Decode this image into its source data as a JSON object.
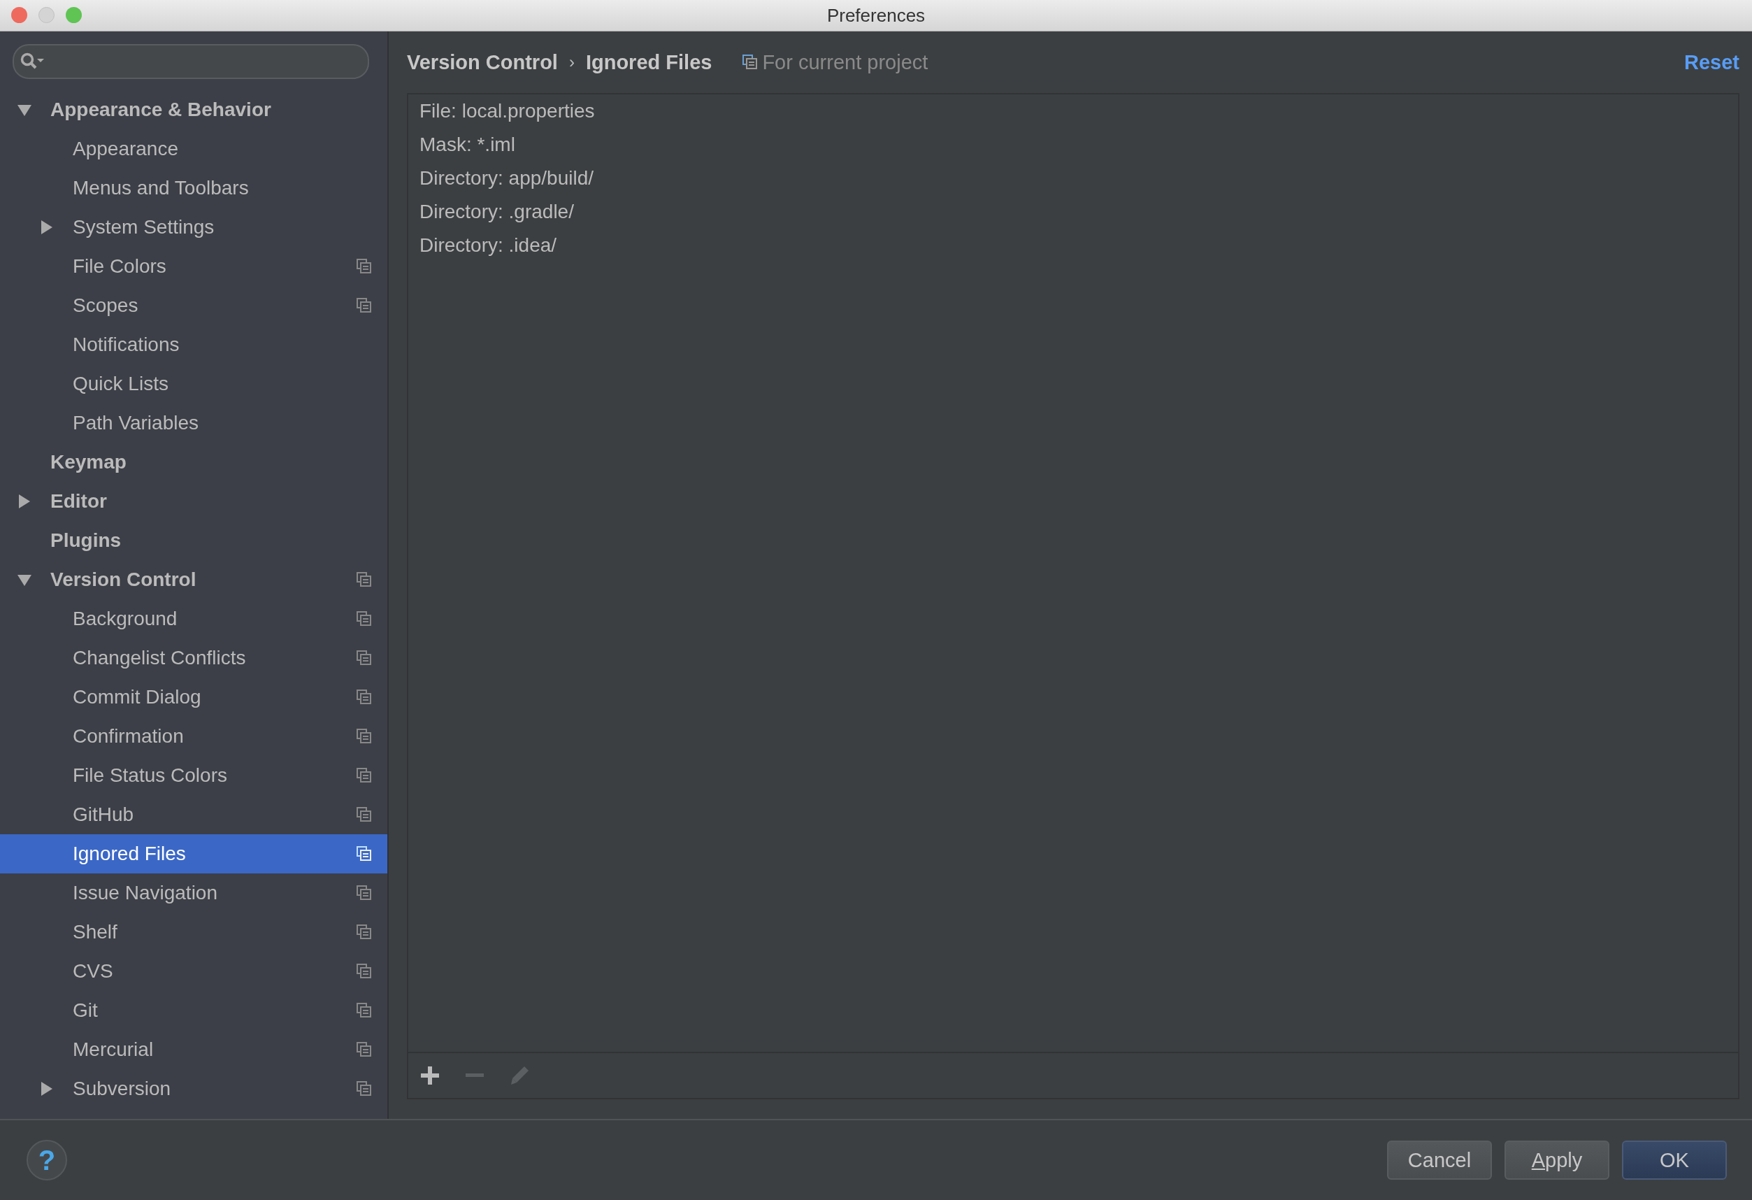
{
  "window": {
    "title": "Preferences"
  },
  "sidebar": {
    "items": [
      {
        "label": "Appearance & Behavior",
        "selected": false,
        "expanded": true,
        "project_level": false,
        "children": [
          {
            "label": "Appearance",
            "selected": false,
            "project_level": false
          },
          {
            "label": "Menus and Toolbars",
            "selected": false,
            "project_level": false
          },
          {
            "label": "System Settings",
            "selected": false,
            "expanded": false,
            "project_level": false
          },
          {
            "label": "File Colors",
            "selected": false,
            "project_level": true
          },
          {
            "label": "Scopes",
            "selected": false,
            "project_level": true
          },
          {
            "label": "Notifications",
            "selected": false,
            "project_level": false
          },
          {
            "label": "Quick Lists",
            "selected": false,
            "project_level": false
          },
          {
            "label": "Path Variables",
            "selected": false,
            "project_level": false
          }
        ]
      },
      {
        "label": "Keymap",
        "selected": false,
        "project_level": false
      },
      {
        "label": "Editor",
        "selected": false,
        "expanded": false,
        "project_level": false
      },
      {
        "label": "Plugins",
        "selected": false,
        "project_level": false
      },
      {
        "label": "Version Control",
        "selected": false,
        "expanded": true,
        "project_level": true,
        "children": [
          {
            "label": "Background",
            "selected": false,
            "project_level": true
          },
          {
            "label": "Changelist Conflicts",
            "selected": false,
            "project_level": true
          },
          {
            "label": "Commit Dialog",
            "selected": false,
            "project_level": true
          },
          {
            "label": "Confirmation",
            "selected": false,
            "project_level": true
          },
          {
            "label": "File Status Colors",
            "selected": false,
            "project_level": true
          },
          {
            "label": "GitHub",
            "selected": false,
            "project_level": true
          },
          {
            "label": "Ignored Files",
            "selected": true,
            "project_level": true
          },
          {
            "label": "Issue Navigation",
            "selected": false,
            "project_level": true
          },
          {
            "label": "Shelf",
            "selected": false,
            "project_level": true
          },
          {
            "label": "CVS",
            "selected": false,
            "project_level": true
          },
          {
            "label": "Git",
            "selected": false,
            "project_level": true
          },
          {
            "label": "Mercurial",
            "selected": false,
            "project_level": true
          },
          {
            "label": "Subversion",
            "selected": false,
            "expanded": false,
            "project_level": true
          }
        ]
      }
    ]
  },
  "header": {
    "breadcrumb": [
      "Version Control",
      "›",
      "Ignored Files"
    ],
    "scope": "For current project",
    "reset": "Reset"
  },
  "ignored_list": [
    "File: local.properties",
    "Mask: *.iml",
    "Directory: app/build/",
    "Directory: .gradle/",
    "Directory: .idea/"
  ],
  "toolbar": [
    {
      "kind": "add",
      "disabled": false
    },
    {
      "kind": "remove",
      "disabled": true
    },
    {
      "kind": "edit",
      "disabled": true
    }
  ],
  "help": {
    "label": "?"
  },
  "buttons": [
    {
      "label": "Cancel",
      "default": false,
      "mnemonic": false
    },
    {
      "label": "Apply",
      "default": false,
      "mnemonic": true
    },
    {
      "label": "OK",
      "default": true,
      "mnemonic": false
    }
  ]
}
